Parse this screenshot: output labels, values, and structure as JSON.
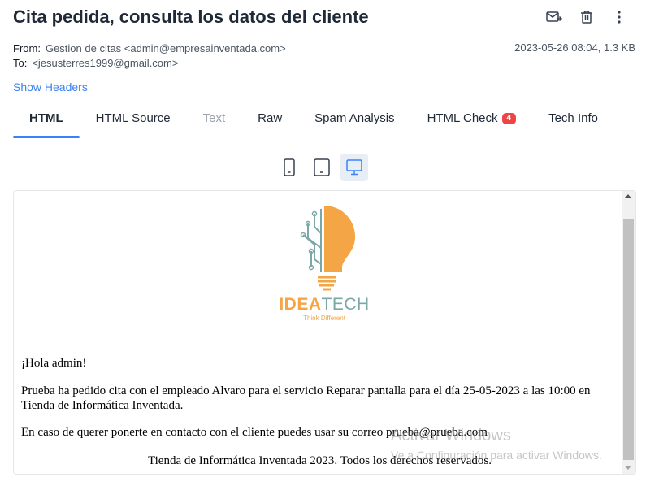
{
  "message": {
    "subject": "Cita pedida, consulta los datos del cliente",
    "from_label": "From:",
    "from_value": "Gestion de citas <admin@empresainventada.com>",
    "to_label": "To:",
    "to_value": "<jesusterres1999@gmail.com>",
    "date_size": "2023-05-26 08:04, 1.3 KB",
    "show_headers": "Show Headers"
  },
  "actions": [
    {
      "icon": "forward-mail-icon"
    },
    {
      "icon": "trash-icon"
    },
    {
      "icon": "more-vertical-icon"
    }
  ],
  "tabs": [
    {
      "label": "HTML",
      "state": "active"
    },
    {
      "label": "HTML Source"
    },
    {
      "label": "Text",
      "state": "disabled"
    },
    {
      "label": "Raw"
    },
    {
      "label": "Spam Analysis"
    },
    {
      "label": "HTML Check",
      "badge": "4"
    },
    {
      "label": "Tech Info"
    }
  ],
  "devices": [
    {
      "icon": "mobile-icon"
    },
    {
      "icon": "tablet-icon"
    },
    {
      "icon": "desktop-icon",
      "state": "active"
    }
  ],
  "email_body": {
    "logo_text_primary": "IDEA",
    "logo_text_secondary": "TECH",
    "logo_tagline": "Think Different",
    "greeting": "¡Hola admin!",
    "paragraph": "Prueba ha pedido cita con el empleado Alvaro para el servicio Reparar pantalla para el día 25-05-2023 a las 10:00 en Tienda de Informática Inventada.",
    "contact": "En caso de querer ponerte en contacto con el cliente puedes usar su correo prueba@prueba.com",
    "footer": "Tienda de Informática Inventada 2023. Todos los derechos reservados."
  },
  "watermark": {
    "line1": "Activar Windows",
    "line2": "Ve a Configuración para activar Windows."
  },
  "colors": {
    "accent": "#3b82f6",
    "badge": "#ef4444",
    "logo_orange": "#f4a545",
    "logo_teal": "#7aa8a8"
  }
}
